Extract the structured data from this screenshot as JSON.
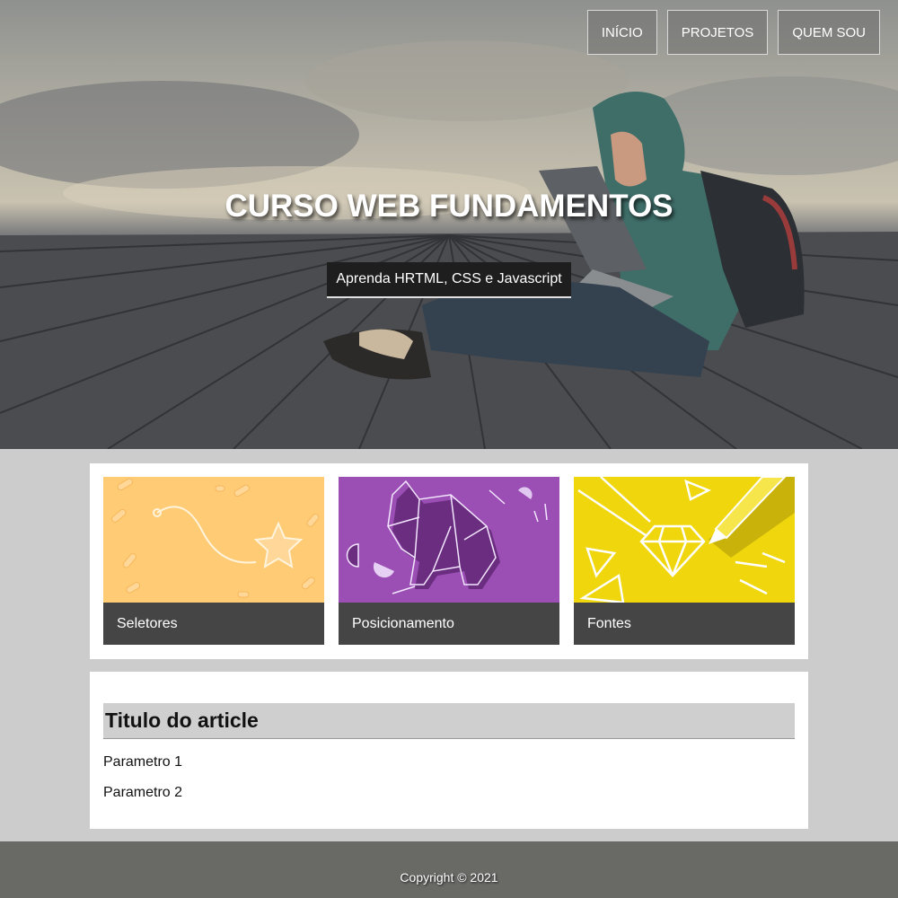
{
  "nav": {
    "items": [
      {
        "label": "INÍCIO"
      },
      {
        "label": "PROJETOS"
      },
      {
        "label": "QUEM SOU"
      }
    ]
  },
  "hero": {
    "title": "CURSO WEB FUNDAMENTOS",
    "subtitle": "Aprenda HRTML, CSS e Javascript"
  },
  "cards": [
    {
      "label": "Seletores",
      "color": "#ffcb75",
      "icon": "star-path-illustration"
    },
    {
      "label": "Posicionamento",
      "color": "#9b4fb4",
      "icon": "origami-elephant-illustration"
    },
    {
      "label": "Fontes",
      "color": "#f0d60c",
      "icon": "diamond-pencil-illustration"
    }
  ],
  "article": {
    "title": "Titulo do article",
    "params": [
      "Parametro 1",
      "Parametro 2"
    ]
  },
  "footer": {
    "text": "Copyright © 2021"
  }
}
